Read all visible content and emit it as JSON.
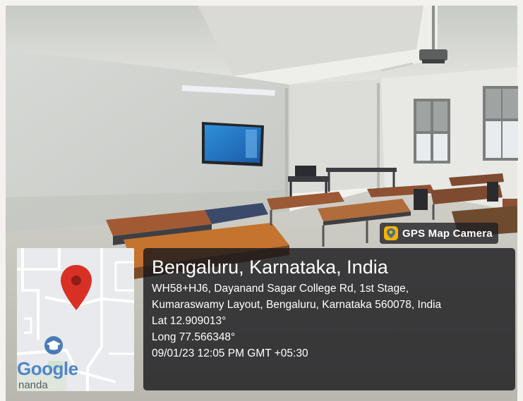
{
  "badge": {
    "app_name": "GPS Map Camera",
    "logo_icon": "gps-map-camera-logo"
  },
  "location": {
    "place": "Bengaluru, Karnataka, India",
    "address_line1": "WH58+HJ6, Dayanand Sagar College Rd, 1st Stage,",
    "address_line2": "Kumaraswamy Layout, Bengaluru, Karnataka 560078, India",
    "latitude": "Lat 12.909013°",
    "longitude": "Long 77.566348°",
    "datetime": "09/01/23 12:05 PM GMT +05:30"
  },
  "map": {
    "brand": "Google",
    "partial_label": "nanda",
    "marker_icon": "map-pin-icon",
    "poi_icon": "graduation-cap-icon"
  },
  "colors": {
    "panel": "#16161a",
    "pin": "#d93025",
    "badge_logo": "#f5b301"
  }
}
